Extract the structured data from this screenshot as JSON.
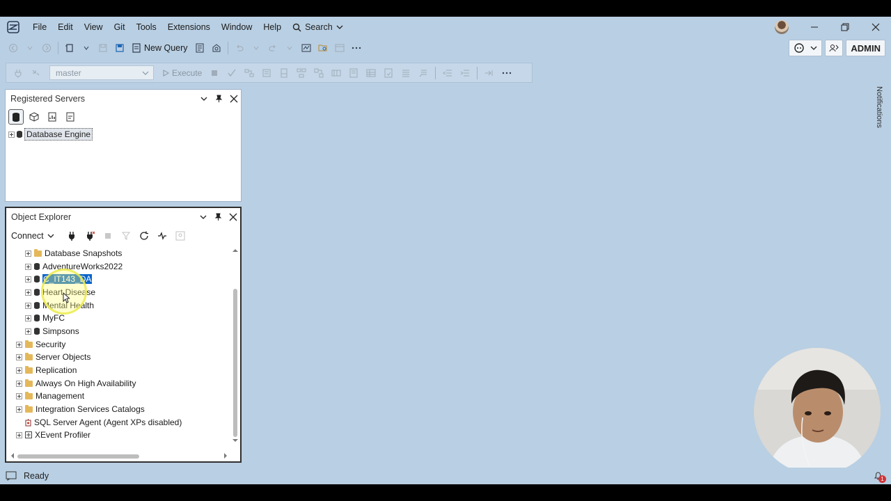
{
  "menu": {
    "items": [
      "File",
      "Edit",
      "View",
      "Git",
      "Tools",
      "Extensions",
      "Window",
      "Help"
    ],
    "search_label": "Search"
  },
  "toolbar": {
    "new_query_label": "New Query",
    "admin_label": "ADMIN",
    "database_select": "master",
    "execute_label": "Execute"
  },
  "registered_servers": {
    "title": "Registered Servers",
    "tree_item": "Database Engine"
  },
  "object_explorer": {
    "title": "Object Explorer",
    "connect_label": "Connect",
    "databases": [
      "Database Snapshots",
      "AdventureWorks2022",
      "C_IT143_DA",
      "Heart Disease",
      "Mental Health",
      "MyFC",
      "Simpsons"
    ],
    "server_nodes": [
      "Security",
      "Server Objects",
      "Replication",
      "Always On High Availability",
      "Management",
      "Integration Services Catalogs",
      "SQL Server Agent (Agent XPs disabled)",
      "XEvent Profiler"
    ]
  },
  "notifications_label": "Notifications",
  "status": {
    "text": "Ready",
    "notification_count": "1"
  },
  "colors": {
    "app_background": "#b9cfe3",
    "selection": "#0a64c8",
    "cursor_highlight": "#ebeb50"
  }
}
